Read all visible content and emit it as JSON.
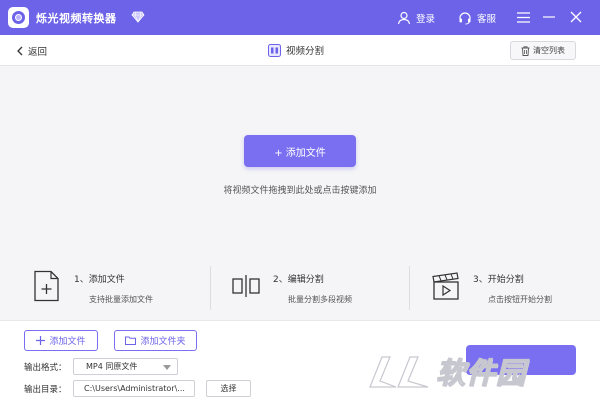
{
  "titlebar": {
    "app_title": "烁光视频转换器",
    "login_label": "登录",
    "service_label": "客服",
    "icons": [
      "app-logo",
      "gem-icon",
      "user-icon",
      "headset-icon",
      "menu-icon",
      "minimize-icon",
      "close-icon"
    ],
    "background": "#6c63e8"
  },
  "nav": {
    "back_label": "返回",
    "title": "视频分割",
    "clear_label": "清空列表"
  },
  "dropzone": {
    "add_button_label": "+ 添加文件",
    "hint": "将视频文件拖拽到此处或点击按键添加"
  },
  "steps": [
    {
      "title": "1、添加文件",
      "desc": "支持批量添加文件",
      "icon": "file-plus-icon"
    },
    {
      "title": "2、编辑分割",
      "desc": "批量分割多段视频",
      "icon": "split-icon"
    },
    {
      "title": "3、开始分割",
      "desc": "点击按钮开始分割",
      "icon": "clapper-play-icon"
    }
  ],
  "bottom": {
    "add_file_label": "添加文件",
    "add_folder_label": "添加文件夹",
    "format_label": "输出格式：",
    "format_value": "MP4 同原文件",
    "dir_label": "输出目录：",
    "dir_value": "C:\\Users\\Administrator\\...",
    "choose_label": "选择"
  },
  "watermark": {
    "text": "软件园"
  },
  "colors": {
    "accent": "#7a6ff0",
    "panel": "#f5f5f7"
  }
}
